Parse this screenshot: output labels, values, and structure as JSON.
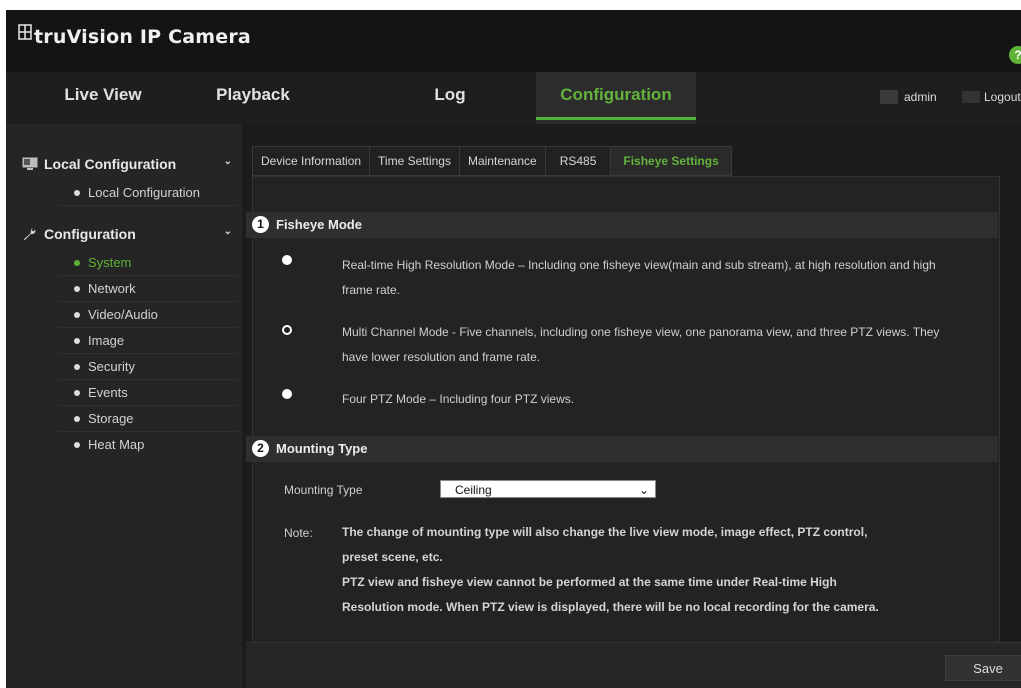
{
  "app": {
    "brand": "truVision IP Camera",
    "help_icon": "?"
  },
  "nav": {
    "tabs": [
      {
        "label": "Live View"
      },
      {
        "label": "Playback"
      },
      {
        "label": "Log"
      },
      {
        "label": "Configuration"
      }
    ],
    "active_tab": "Configuration",
    "user": "admin",
    "logout": "Logout"
  },
  "sidebar": {
    "local_section": "Local Configuration",
    "local_items": [
      "Local Configuration"
    ],
    "config_section": "Configuration",
    "config_items": [
      "System",
      "Network",
      "Video/Audio",
      "Image",
      "Security",
      "Events",
      "Storage",
      "Heat Map"
    ],
    "active_item": "System"
  },
  "subtabs": [
    "Device Information",
    "Time Settings",
    "Maintenance",
    "RS485",
    "Fisheye Settings"
  ],
  "active_subtab": "Fisheye Settings",
  "fisheye": {
    "marker": "1",
    "title": "Fisheye Mode",
    "options": [
      {
        "text_line1": "Real-time High Resolution Mode – Including one fisheye view(main and sub stream), at high resolution and high",
        "text_line2": "frame rate.",
        "selected": false
      },
      {
        "text_line1": "Multi Channel Mode - Five channels, including one fisheye view, one panorama view, and three PTZ views. They",
        "text_line2": "have lower resolution and frame rate.",
        "selected": true
      },
      {
        "text_line1": "Four PTZ Mode – Including four PTZ views.",
        "text_line2": "",
        "selected": false
      }
    ]
  },
  "mounting": {
    "marker": "2",
    "title": "Mounting Type",
    "field_label": "Mounting Type",
    "value": "Ceiling",
    "note_label": "Note:",
    "note_lines": [
      "The change of mounting type will also change the live view mode, image effect, PTZ control,",
      "preset scene, etc.",
      "PTZ view and fisheye view cannot be performed at the same time under Real-time High",
      "Resolution mode. When PTZ view is displayed, there will be no local recording for the camera."
    ]
  },
  "footer": {
    "save_label": "Save"
  },
  "colors": {
    "accent": "#5fb336",
    "background": "#1c1c1c"
  }
}
